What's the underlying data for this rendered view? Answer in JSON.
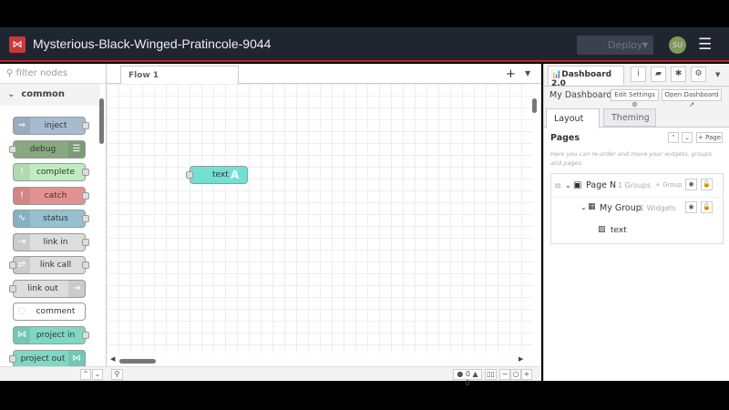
{
  "header": {
    "title": "Mysterious-Black-Winged-Pratincole-9044",
    "deploy_label": "Deploy",
    "avatar_initials": "SU"
  },
  "palette": {
    "filter_placeholder": "filter nodes",
    "category": "common",
    "nodes": [
      {
        "label": "inject",
        "color": "#a6bbcf"
      },
      {
        "label": "debug",
        "color": "#87a980"
      },
      {
        "label": "complete",
        "color": "#c0edc0"
      },
      {
        "label": "catch",
        "color": "#e49191"
      },
      {
        "label": "status",
        "color": "#94c1d0"
      },
      {
        "label": "link in",
        "color": "#dddddd"
      },
      {
        "label": "link call",
        "color": "#dddddd"
      },
      {
        "label": "link out",
        "color": "#dddddd"
      },
      {
        "label": "comment",
        "color": "#ffffff"
      },
      {
        "label": "project in",
        "color": "#7fd8c3"
      },
      {
        "label": "project out",
        "color": "#7fd8c3"
      }
    ]
  },
  "workspace": {
    "tab": "Flow 1",
    "node_label": "text",
    "errors": "0",
    "warnings": "0"
  },
  "sidebar": {
    "tab": "Dashboard 2.0",
    "dashboard_name": "My Dashboard",
    "edit_settings": "Edit Settings",
    "open_dashboard": "Open Dashboard",
    "tabs": [
      "Layout",
      "Theming"
    ],
    "pages_heading": "Pages",
    "add_page": "Page",
    "help": "Here you can re-order and move your widgets, groups and pages.",
    "page_name": "Page N",
    "page_groups": "1 Groups",
    "add_group": "Group",
    "group_name": "My Group",
    "group_widgets": "1 Widgets",
    "widget_name": "text"
  }
}
